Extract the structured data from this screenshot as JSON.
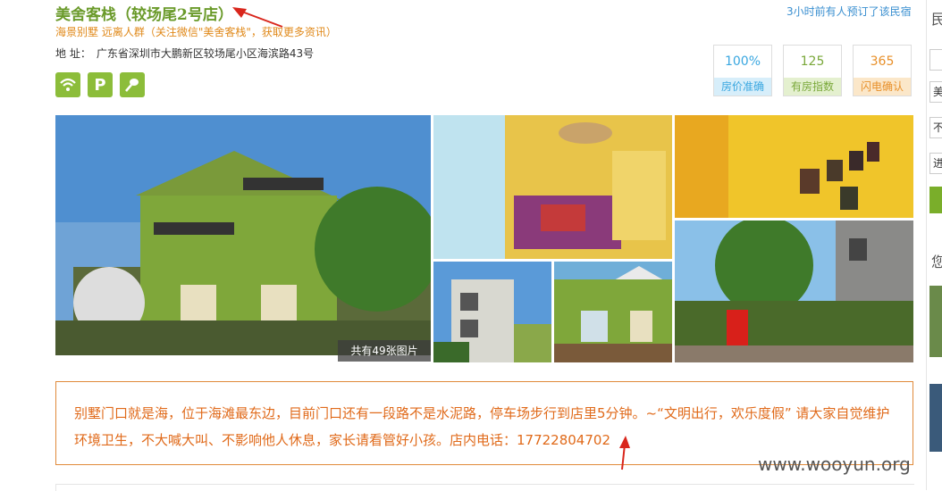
{
  "hotel": {
    "name": "美舍客栈（较场尾2号店）",
    "tagline": "海景别墅 远离人群（关注微信\"美舍客栈\"，获取更多资讯）",
    "address_label": "地 址：",
    "address": "广东省深圳市大鹏新区较场尾小区海滨路43号",
    "recent_booking": "3小时前有人预订了该民宿"
  },
  "amenities": [
    {
      "icon": "wifi-icon",
      "glyph": "≋"
    },
    {
      "icon": "parking-icon",
      "glyph": "P"
    },
    {
      "icon": "breakfast-icon",
      "glyph": "⚲"
    }
  ],
  "stats": [
    {
      "value": "100%",
      "label": "房价准确",
      "color": "#3aa7e0",
      "bg": "#d7eefa"
    },
    {
      "value": "125",
      "label": "有房指数",
      "color": "#7aa83a",
      "bg": "#e4f0cf"
    },
    {
      "value": "365",
      "label": "闪电确认",
      "color": "#e8902a",
      "bg": "#fbe7c9"
    }
  ],
  "gallery": {
    "photo_count": "共有49张图片"
  },
  "description": "别墅门口就是海，位于海滩最东边，目前门口还有一段路不是水泥路，停车场步行到店里5分钟。~“文明出行，欢乐度假” 请大家自觉维护环境卫生，不大喊大叫、不影响他人休息，家长请看管好小孩。店内电话：17722804702",
  "watermark": "www.wooyun.org",
  "right_sidebar": {
    "labels": [
      "民",
      "美",
      "不",
      "进",
      "您"
    ]
  },
  "colors": {
    "brand_green": "#8cbd3a",
    "title_green": "#6a9a2a",
    "orange": "#e0891a",
    "arrow_red": "#d9261c"
  }
}
